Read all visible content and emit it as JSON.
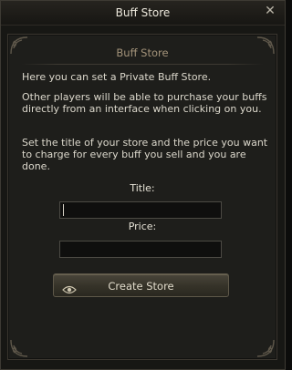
{
  "window": {
    "title": "Buff Store",
    "close_glyph": "✕"
  },
  "panel": {
    "header": "Buff Store",
    "paragraphs": [
      "Here you can set a Private Buff Store.",
      "Other players will be able to purchase your buffs directly from an interface when clicking on you.",
      "Set the title of your store and the price you want to charge for every buff you sell and you are done."
    ],
    "title_label": "Title:",
    "title_value": "",
    "price_label": "Price:",
    "price_value": "",
    "create_button_label": "Create Store",
    "create_button_icon": "eye-icon"
  },
  "colors": {
    "panel_bg": "#1e1e1b",
    "header_text": "#a3937a",
    "body_text": "#dcd8cc",
    "field_bg": "#0f0f0e",
    "button_bg": "#353228"
  }
}
